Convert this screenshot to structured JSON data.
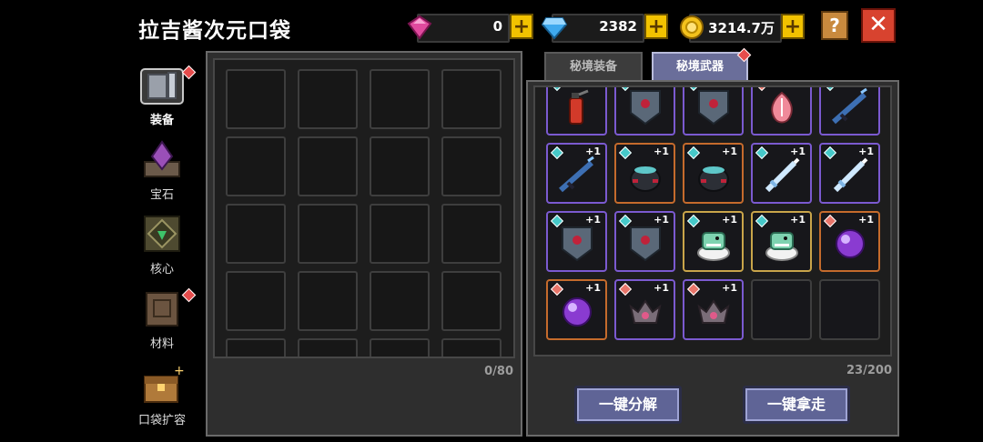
{
  "header": {
    "title": "拉吉酱次元口袋",
    "currencies": [
      {
        "name": "pink-gem",
        "value": "0",
        "color": "#e04a9e"
      },
      {
        "name": "blue-gem",
        "value": "2382",
        "color": "#3fa9ee"
      },
      {
        "name": "gold-coin",
        "value": "3214.7万",
        "color": "#f4c21c"
      }
    ],
    "help_label": "?",
    "close_label": "✕"
  },
  "sidebar": [
    {
      "label": "装备",
      "icon": "armor-icon",
      "active": true,
      "dot": true
    },
    {
      "label": "宝石",
      "icon": "gem-crystal-icon",
      "active": false,
      "dot": false
    },
    {
      "label": "核心",
      "icon": "core-icon",
      "active": false,
      "dot": false
    },
    {
      "label": "材料",
      "icon": "material-icon",
      "active": false,
      "dot": true
    },
    {
      "label": "口袋扩容",
      "icon": "chest-expand-icon",
      "active": false,
      "dot": false
    }
  ],
  "left_panel": {
    "count": "0/80"
  },
  "tabs": [
    {
      "label": "秘境装备",
      "active": false
    },
    {
      "label": "秘境武器",
      "active": true
    }
  ],
  "right_panel": {
    "count": "23/200",
    "items": [
      {
        "icon": "fire-extinguisher-icon",
        "quality": "purple",
        "level": "",
        "gem": "#46c9c9"
      },
      {
        "icon": "shield-icon",
        "quality": "purple",
        "level": "",
        "gem": "#46c9c9"
      },
      {
        "icon": "shield-icon",
        "quality": "purple",
        "level": "",
        "gem": "#46c9c9"
      },
      {
        "icon": "peach-icon",
        "quality": "purple",
        "level": "",
        "gem": "#e8756a"
      },
      {
        "icon": "rifle-icon",
        "quality": "purple",
        "level": "",
        "gem": "#46c9c9"
      },
      {
        "icon": "rifle-icon",
        "quality": "purple",
        "level": "+1",
        "gem": "#46c9c9"
      },
      {
        "icon": "cauldron-icon",
        "quality": "orange",
        "level": "+1",
        "gem": "#46c9c9"
      },
      {
        "icon": "cauldron-icon",
        "quality": "orange",
        "level": "+1",
        "gem": "#46c9c9"
      },
      {
        "icon": "ice-sword-icon",
        "quality": "purple",
        "level": "+1",
        "gem": "#46c9c9"
      },
      {
        "icon": "ice-sword-icon",
        "quality": "purple",
        "level": "+1",
        "gem": "#46c9c9"
      },
      {
        "icon": "shield-icon",
        "quality": "purple",
        "level": "+1",
        "gem": "#46c9c9"
      },
      {
        "icon": "shield-icon",
        "quality": "purple",
        "level": "+1",
        "gem": "#46c9c9"
      },
      {
        "icon": "dino-icon",
        "quality": "gold",
        "level": "+1",
        "gem": "#46c9c9"
      },
      {
        "icon": "dino-icon",
        "quality": "gold",
        "level": "+1",
        "gem": "#46c9c9"
      },
      {
        "icon": "orb-icon",
        "quality": "orange",
        "level": "+1",
        "gem": "#e8756a"
      },
      {
        "icon": "orb-icon",
        "quality": "orange",
        "level": "+1",
        "gem": "#e8756a"
      },
      {
        "icon": "crown-icon",
        "quality": "purple",
        "level": "+1",
        "gem": "#e8756a"
      },
      {
        "icon": "crown-icon",
        "quality": "purple",
        "level": "+1",
        "gem": "#e8756a"
      },
      {
        "icon": "",
        "quality": "empty",
        "level": "",
        "gem": ""
      },
      {
        "icon": "",
        "quality": "empty",
        "level": "",
        "gem": ""
      }
    ]
  },
  "buttons": {
    "decompose": "一键分解",
    "take_all": "一键拿走"
  }
}
